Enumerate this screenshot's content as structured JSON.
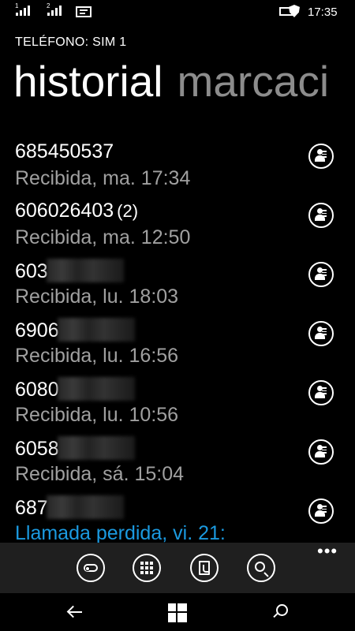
{
  "status_bar": {
    "sim1_label": "1",
    "sim2_label": "2",
    "time": "17:35"
  },
  "header": {
    "app_title": "TELÉFONO: SIM 1",
    "pivot_active": "historial",
    "pivot_next": "marcaci"
  },
  "calls": [
    {
      "number": "685450537",
      "count": "",
      "detail": "Recibida, ma. 17:34",
      "masked": false,
      "missed": false
    },
    {
      "number": "606026403",
      "count": "(2)",
      "detail": "Recibida, ma. 12:50",
      "masked": false,
      "missed": false
    },
    {
      "number": "603",
      "count": "",
      "detail": "Recibida, lu. 18:03",
      "masked": true,
      "missed": false
    },
    {
      "number": "6906",
      "count": "",
      "detail": "Recibida, lu. 16:56",
      "masked": true,
      "missed": false
    },
    {
      "number": "6080",
      "count": "",
      "detail": "Recibida, lu. 10:56",
      "masked": true,
      "missed": false
    },
    {
      "number": "6058",
      "count": "",
      "detail": "Recibida, sá. 15:04",
      "masked": true,
      "missed": false
    },
    {
      "number": "687",
      "count": "",
      "detail": "Llamada perdida, vi. 21:",
      "masked": true,
      "missed": true
    }
  ],
  "app_bar": {
    "buttons": [
      "voicemail-icon",
      "keypad-icon",
      "phonebook-icon",
      "search-icon"
    ],
    "more": "•••"
  },
  "colors": {
    "background": "#000000",
    "secondary_text": "#a0a0a0",
    "accent": "#1b9ae0",
    "app_bar": "#1f1f1f"
  }
}
